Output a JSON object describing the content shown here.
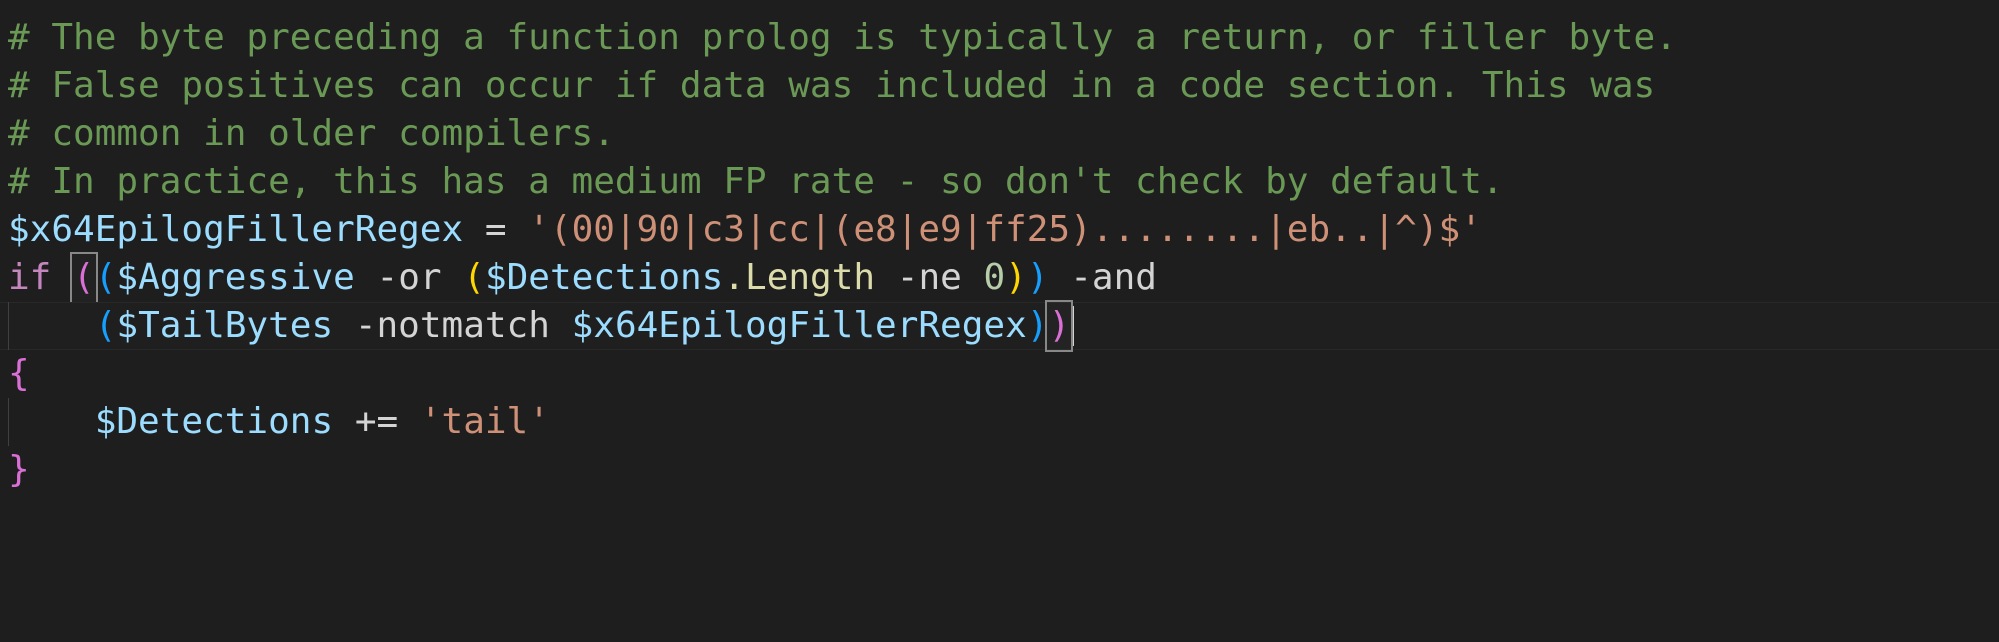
{
  "editor": {
    "language": "powershell",
    "theme": "dark-plus",
    "background_color": "#1e1e1e",
    "current_line_number": 7,
    "cursor_visible": true,
    "colors": {
      "comment": "#6a9955",
      "variable": "#9cdcfe",
      "string": "#ce9178",
      "keyword": "#c586c0",
      "operator": "#d4d4d4",
      "property": "#dcdcaa",
      "number": "#b5cea8",
      "bracket_gold": "#ffd700",
      "bracket_orchid": "#da70d6",
      "bracket_blue": "#179fff",
      "indent_guide": "#404040",
      "bracket_match_border": "#888888"
    }
  },
  "code": {
    "line1": {
      "comment": "# The byte preceding a function prolog is typically a return, or filler byte."
    },
    "line2": {
      "comment": "# False positives can occur if data was included in a code section. This was"
    },
    "line3": {
      "comment": "# common in older compilers."
    },
    "line4": {
      "comment": "# In practice, this has a medium FP rate - so don't check by default."
    },
    "line5": {
      "variable": "$x64EpilogFillerRegex",
      "equals": "=",
      "string": "'(00|90|c3|cc|(e8|e9|ff25)........|eb..|^)$'"
    },
    "line6": {
      "keyword": "if",
      "paren_outer_open": "(",
      "paren_inner_open": "(",
      "var_aggressive": "$Aggressive",
      "op_or": "-or",
      "paren_len_open": "(",
      "var_detections": "$Detections",
      "property": ".Length",
      "op_ne": "-ne",
      "number": "0",
      "paren_len_close": ")",
      "paren_inner_close": ")",
      "op_and": "-and"
    },
    "line7": {
      "indent": "    ",
      "paren_open": "(",
      "var_tailbytes": "$TailBytes",
      "op_notmatch": "-notmatch",
      "var_regex": "$x64EpilogFillerRegex",
      "paren_close": ")",
      "paren_outer_close": ")"
    },
    "line8": {
      "brace_open": "{"
    },
    "line9": {
      "indent": "    ",
      "variable": "$Detections",
      "op_plus_equals": "+=",
      "string": "'tail'"
    },
    "line10": {
      "brace_close": "}"
    }
  }
}
